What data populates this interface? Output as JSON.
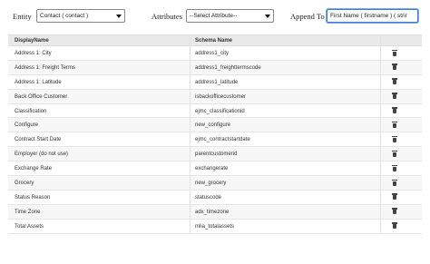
{
  "toolbar": {
    "entity_label": "Entity",
    "entity_value": "Contact ( contact )",
    "attributes_label": "Attributes",
    "attributes_value": "--Select Attribute--",
    "append_label": "Append To",
    "append_value": "First Name ( firstname ) ( strir"
  },
  "table": {
    "columns": [
      "DisplayName",
      "Schema Name"
    ],
    "rows": [
      {
        "display": "Address 1: City",
        "schema": "address1_city"
      },
      {
        "display": "Address 1: Freight Terms",
        "schema": "address1_freighttermscode"
      },
      {
        "display": "Address 1: Latitude",
        "schema": "address1_latitude"
      },
      {
        "display": "Back Office Customer",
        "schema": "isbackofficecustomer"
      },
      {
        "display": "Classification",
        "schema": "ejmc_classificationid"
      },
      {
        "display": "Configure",
        "schema": "new_configure"
      },
      {
        "display": "Contract Start Date",
        "schema": "ejmc_contractstartdate"
      },
      {
        "display": "Employer (do not use)",
        "schema": "parentcustomerid"
      },
      {
        "display": "Exchange Rate",
        "schema": "exchangerate"
      },
      {
        "display": "Grocery",
        "schema": "new_grocery"
      },
      {
        "display": "Status Reason",
        "schema": "statuscode"
      },
      {
        "display": "Time Zone",
        "schema": "adx_timezone"
      },
      {
        "display": "Total Assets",
        "schema": "mlia_totalassets"
      }
    ],
    "row_icon": "trash-icon"
  },
  "colors": {
    "header_bg": "#e9e9e9",
    "focus_border": "#3b7dd8"
  }
}
